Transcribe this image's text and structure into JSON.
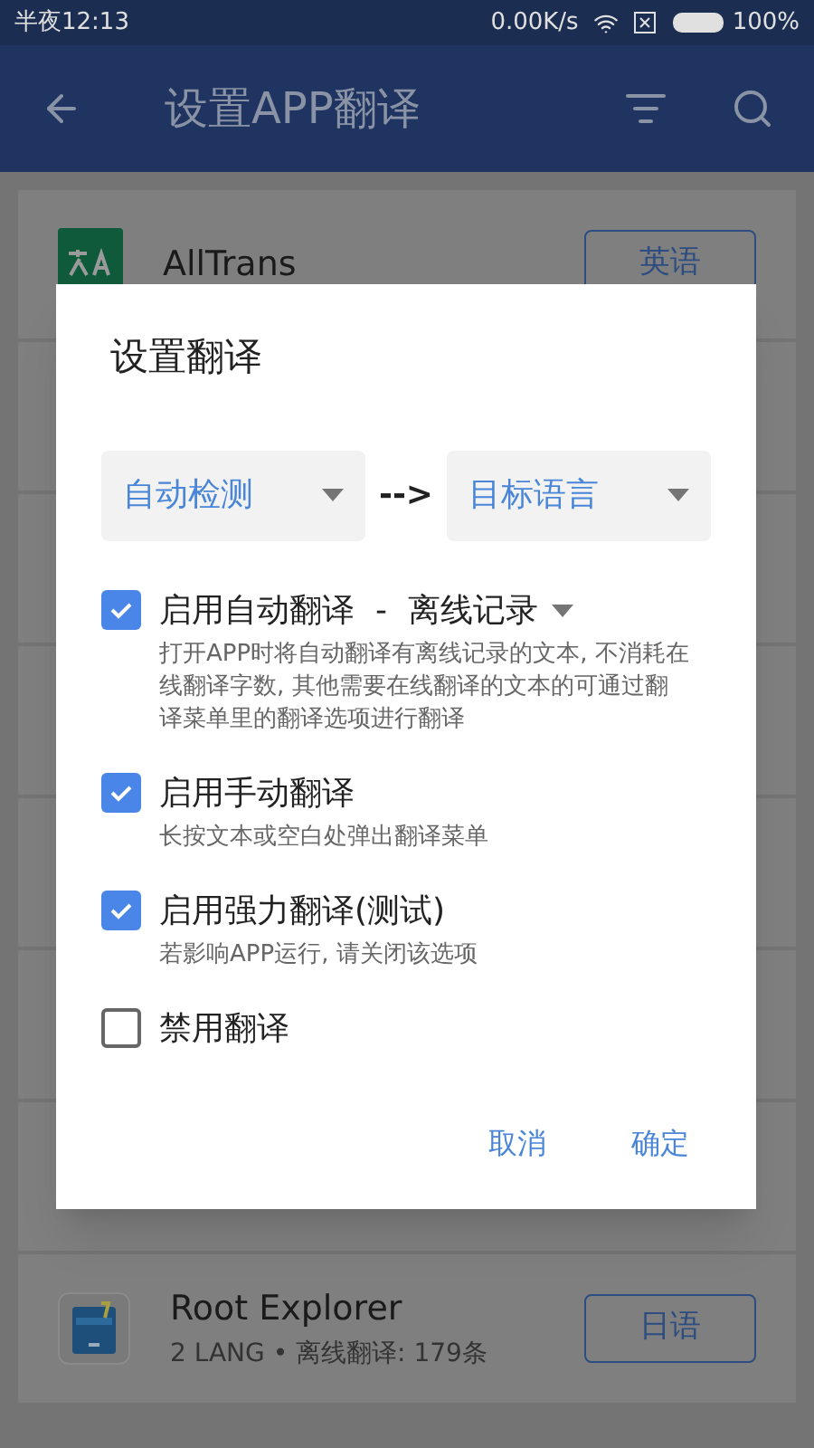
{
  "status_bar": {
    "time": "半夜12:13",
    "speed": "0.00K/s",
    "battery": "100%"
  },
  "toolbar": {
    "title": "设置APP翻译"
  },
  "apps": [
    {
      "name": "AllTrans",
      "language": "英语",
      "kind": "translate"
    },
    {
      "name": "Root Explorer",
      "subtitle": "2 LANG • 离线翻译: 179条",
      "language": "日语",
      "kind": "folder"
    }
  ],
  "dialog": {
    "title": "设置翻译",
    "source_language": "自动检测",
    "arrow": "-->",
    "target_language": "目标语言",
    "options": [
      {
        "kind": "dropdown",
        "label": "启用自动翻译  -  离线记录",
        "description": "打开APP时将自动翻译有离线记录的文本, 不消耗在线翻译字数, 其他需要在线翻译的文本的可通过翻译菜单里的翻译选项进行翻译",
        "checked": true
      },
      {
        "kind": "plain",
        "label": "启用手动翻译",
        "description": "长按文本或空白处弹出翻译菜单",
        "checked": true
      },
      {
        "kind": "plain",
        "label": "启用强力翻译(测试)",
        "description": "若影响APP运行, 请关闭该选项",
        "checked": true
      },
      {
        "kind": "plain",
        "label": "禁用翻译",
        "checked": false
      }
    ],
    "buttons": [
      "取消",
      "确定"
    ]
  }
}
